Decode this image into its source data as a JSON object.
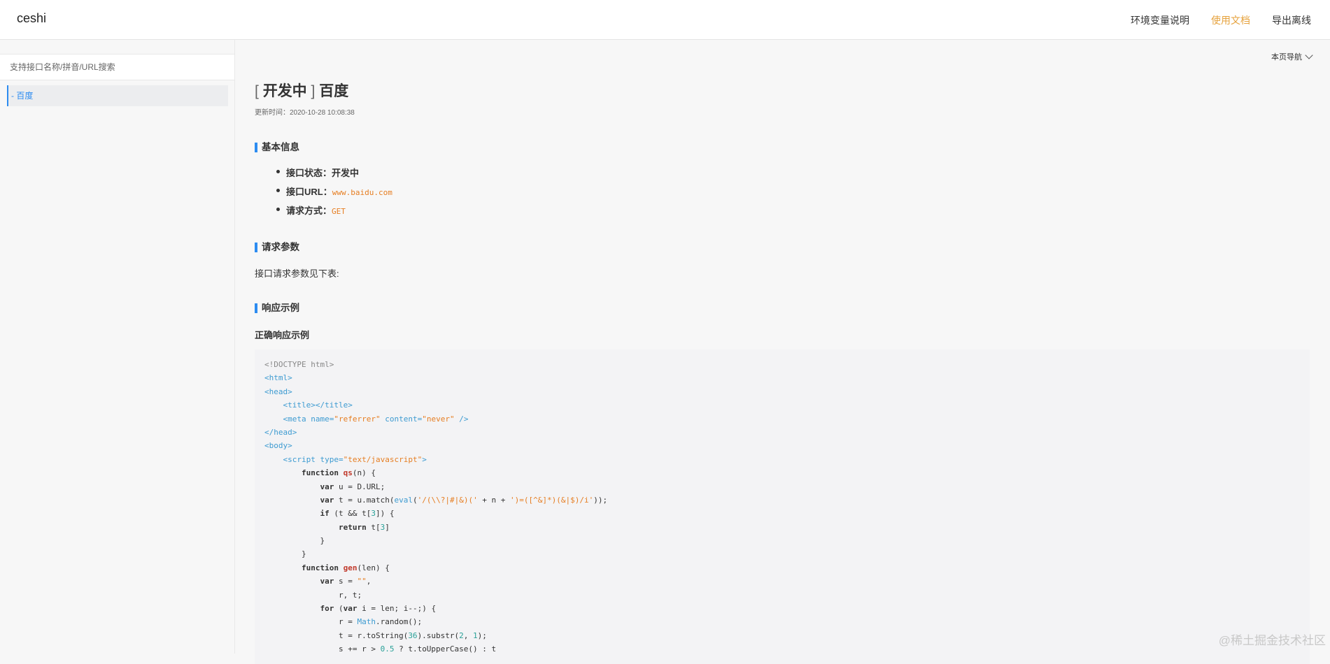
{
  "header": {
    "brand": "ceshi",
    "nav": [
      {
        "label": "环境变量说明",
        "active": false
      },
      {
        "label": "使用文档",
        "active": true
      },
      {
        "label": "导出离线",
        "active": false
      }
    ]
  },
  "sidebar": {
    "search_placeholder": "支持接口名称/拼音/URL搜索",
    "items": [
      {
        "label": "- 百度"
      }
    ]
  },
  "page_nav": {
    "label": "本页导航"
  },
  "doc": {
    "status_prefix": "[",
    "status": "开发中",
    "status_suffix": "]",
    "name": "百度",
    "updated": "更新时间：2020-10-28 10:08:38",
    "basic_info_heading": "基本信息",
    "basic_info": [
      {
        "key": "接口状态：",
        "value": "开发中"
      },
      {
        "key": "接口URL：",
        "value": "www.baidu.com"
      },
      {
        "key": "请求方式：",
        "value": "GET"
      }
    ],
    "params_heading": "请求参数",
    "params_text": "接口请求参数见下表:",
    "response_heading": "响应示例",
    "success_example_heading": "正确响应示例"
  },
  "code": [
    [
      [
        "gray",
        "<!DOCTYPE html>"
      ]
    ],
    [
      [
        "tag",
        "<html>"
      ]
    ],
    [
      [
        "tag",
        "<head>"
      ]
    ],
    [
      [
        "txt",
        "    "
      ],
      [
        "tag",
        "<title></title>"
      ]
    ],
    [
      [
        "txt",
        "    "
      ],
      [
        "tag",
        "<meta "
      ],
      [
        "attr",
        "name="
      ],
      [
        "str",
        "\"referrer\""
      ],
      [
        "attr",
        " content="
      ],
      [
        "str",
        "\"never\""
      ],
      [
        "tag",
        " />"
      ]
    ],
    [
      [
        "tag",
        "</head>"
      ]
    ],
    [
      [
        "tag",
        "<body>"
      ]
    ],
    [
      [
        "txt",
        "    "
      ],
      [
        "tag",
        "<script "
      ],
      [
        "attr",
        "type="
      ],
      [
        "str",
        "\"text/javascript\""
      ],
      [
        "tag",
        ">"
      ]
    ],
    [
      [
        "txt",
        "        "
      ],
      [
        "kw",
        "function "
      ],
      [
        "fn",
        "qs"
      ],
      [
        "txt",
        "(n) {"
      ]
    ],
    [
      [
        "txt",
        "            "
      ],
      [
        "kw",
        "var "
      ],
      [
        "txt",
        "u = D.URL;"
      ]
    ],
    [
      [
        "txt",
        "            "
      ],
      [
        "kw",
        "var "
      ],
      [
        "txt",
        "t = u.match("
      ],
      [
        "tag",
        "eval"
      ],
      [
        "txt",
        "("
      ],
      [
        "str",
        "'/(\\\\?|#|&)('"
      ],
      [
        "txt",
        " + n + "
      ],
      [
        "str",
        "')=([^&]*)(&|$)/i'"
      ],
      [
        "txt",
        "));"
      ]
    ],
    [
      [
        "txt",
        "            "
      ],
      [
        "kw",
        "if "
      ],
      [
        "txt",
        "(t && t["
      ],
      [
        "num",
        "3"
      ],
      [
        "txt",
        "]) {"
      ]
    ],
    [
      [
        "txt",
        "                "
      ],
      [
        "kw",
        "return "
      ],
      [
        "txt",
        "t["
      ],
      [
        "num",
        "3"
      ],
      [
        "txt",
        "]"
      ]
    ],
    [
      [
        "txt",
        "            }"
      ]
    ],
    [
      [
        "txt",
        "        }"
      ]
    ],
    [
      [
        "txt",
        "        "
      ],
      [
        "kw",
        "function "
      ],
      [
        "fn",
        "gen"
      ],
      [
        "txt",
        "(len) {"
      ]
    ],
    [
      [
        "txt",
        "            "
      ],
      [
        "kw",
        "var "
      ],
      [
        "txt",
        "s = "
      ],
      [
        "str",
        "\"\""
      ],
      [
        "txt",
        ","
      ]
    ],
    [
      [
        "txt",
        "                r, t;"
      ]
    ],
    [
      [
        "txt",
        "            "
      ],
      [
        "kw",
        "for "
      ],
      [
        "txt",
        "("
      ],
      [
        "kw",
        "var "
      ],
      [
        "txt",
        "i = len; i--;) {"
      ]
    ],
    [
      [
        "txt",
        "                r = "
      ],
      [
        "tag",
        "Math"
      ],
      [
        "txt",
        ".random();"
      ]
    ],
    [
      [
        "txt",
        "                t = r.toString("
      ],
      [
        "num",
        "36"
      ],
      [
        "txt",
        ").substr("
      ],
      [
        "num",
        "2"
      ],
      [
        "txt",
        ", "
      ],
      [
        "num",
        "1"
      ],
      [
        "txt",
        ");"
      ]
    ],
    [
      [
        "txt",
        "                s += r > "
      ],
      [
        "num",
        "0.5"
      ],
      [
        "txt",
        " ? t.toUpperCase() : t"
      ]
    ]
  ],
  "watermark": "@稀土掘金技术社区"
}
